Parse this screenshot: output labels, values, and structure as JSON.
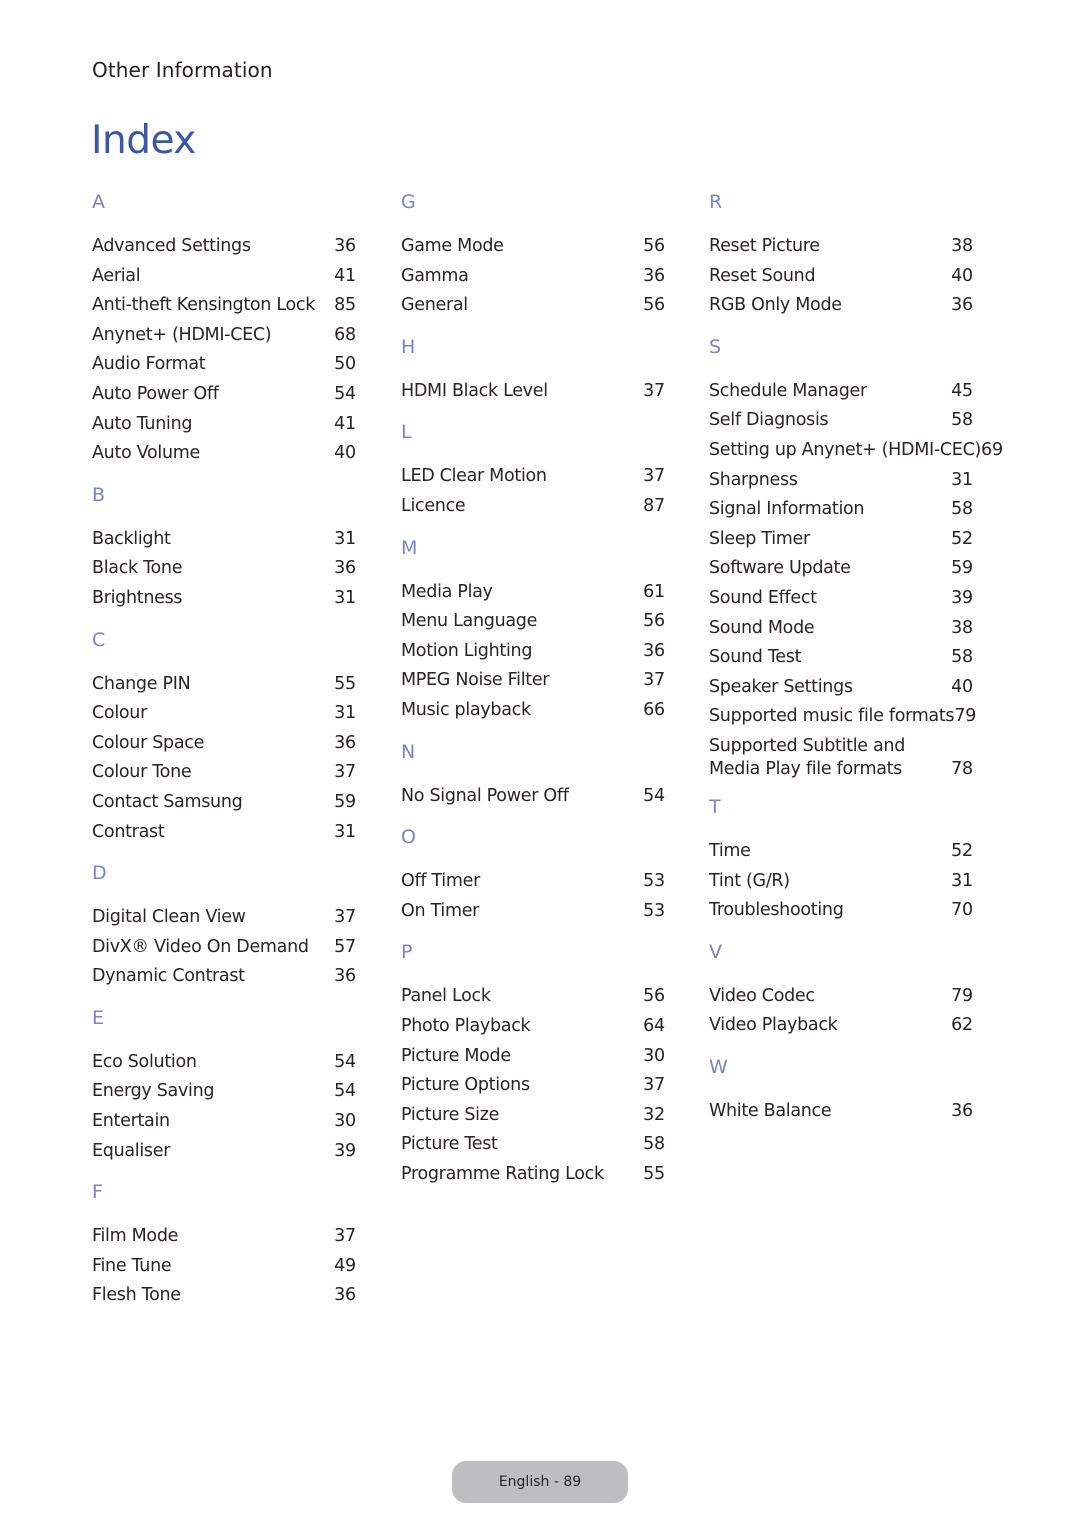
{
  "header": {
    "section": "Other Information",
    "title": "Index"
  },
  "colors": {
    "title": "#3a58a3",
    "letter": "#7b83c4",
    "text": "#2a2326",
    "footer_bg": "#bdbec0"
  },
  "columns": [
    {
      "groups": [
        {
          "letter": "A",
          "entries": [
            {
              "term": "Advanced Settings",
              "page": "36"
            },
            {
              "term": "Aerial",
              "page": "41"
            },
            {
              "term": "Anti-theft Kensington Lock",
              "page": "85"
            },
            {
              "term": "Anynet+ (HDMI-CEC)",
              "page": "68"
            },
            {
              "term": "Audio Format",
              "page": "50"
            },
            {
              "term": "Auto Power Off",
              "page": "54"
            },
            {
              "term": "Auto Tuning",
              "page": "41"
            },
            {
              "term": "Auto Volume",
              "page": "40"
            }
          ]
        },
        {
          "letter": "B",
          "entries": [
            {
              "term": "Backlight",
              "page": "31"
            },
            {
              "term": "Black Tone",
              "page": "36"
            },
            {
              "term": "Brightness",
              "page": "31"
            }
          ]
        },
        {
          "letter": "C",
          "entries": [
            {
              "term": "Change PIN",
              "page": "55"
            },
            {
              "term": "Colour",
              "page": "31"
            },
            {
              "term": "Colour Space",
              "page": "36"
            },
            {
              "term": "Colour Tone",
              "page": "37"
            },
            {
              "term": "Contact Samsung",
              "page": "59"
            },
            {
              "term": "Contrast",
              "page": "31"
            }
          ]
        },
        {
          "letter": "D",
          "entries": [
            {
              "term": "Digital Clean View",
              "page": "37"
            },
            {
              "term": "DivX® Video On Demand",
              "page": "57"
            },
            {
              "term": "Dynamic Contrast",
              "page": "36"
            }
          ]
        },
        {
          "letter": "E",
          "entries": [
            {
              "term": "Eco Solution",
              "page": "54"
            },
            {
              "term": "Energy Saving",
              "page": "54"
            },
            {
              "term": "Entertain",
              "page": "30"
            },
            {
              "term": "Equaliser",
              "page": "39"
            }
          ]
        },
        {
          "letter": "F",
          "entries": [
            {
              "term": "Film Mode",
              "page": "37"
            },
            {
              "term": "Fine Tune",
              "page": "49"
            },
            {
              "term": "Flesh Tone",
              "page": "36"
            }
          ]
        }
      ]
    },
    {
      "groups": [
        {
          "letter": "G",
          "entries": [
            {
              "term": "Game Mode",
              "page": "56"
            },
            {
              "term": "Gamma",
              "page": "36"
            },
            {
              "term": "General",
              "page": "56"
            }
          ]
        },
        {
          "letter": "H",
          "entries": [
            {
              "term": "HDMI Black Level",
              "page": "37"
            }
          ]
        },
        {
          "letter": "L",
          "entries": [
            {
              "term": "LED Clear Motion",
              "page": "37"
            },
            {
              "term": "Licence",
              "page": "87"
            }
          ]
        },
        {
          "letter": "M",
          "entries": [
            {
              "term": "Media Play",
              "page": "61"
            },
            {
              "term": "Menu Language",
              "page": "56"
            },
            {
              "term": "Motion Lighting",
              "page": "36"
            },
            {
              "term": "MPEG Noise Filter",
              "page": "37"
            },
            {
              "term": "Music playback",
              "page": "66"
            }
          ]
        },
        {
          "letter": "N",
          "entries": [
            {
              "term": "No Signal Power Off",
              "page": "54"
            }
          ]
        },
        {
          "letter": "O",
          "entries": [
            {
              "term": "Off Timer",
              "page": "53"
            },
            {
              "term": "On Timer",
              "page": "53"
            }
          ]
        },
        {
          "letter": "P",
          "entries": [
            {
              "term": "Panel Lock",
              "page": "56"
            },
            {
              "term": "Photo Playback",
              "page": "64"
            },
            {
              "term": "Picture Mode",
              "page": "30"
            },
            {
              "term": "Picture Options",
              "page": "37"
            },
            {
              "term": "Picture Size",
              "page": "32"
            },
            {
              "term": "Picture Test",
              "page": "58"
            },
            {
              "term": "Programme Rating Lock",
              "page": "55"
            }
          ]
        }
      ]
    },
    {
      "groups": [
        {
          "letter": "R",
          "entries": [
            {
              "term": "Reset Picture",
              "page": "38"
            },
            {
              "term": "Reset Sound",
              "page": "40"
            },
            {
              "term": "RGB Only Mode",
              "page": "36"
            }
          ]
        },
        {
          "letter": "S",
          "entries": [
            {
              "term": "Schedule Manager",
              "page": "45"
            },
            {
              "term": "Self Diagnosis",
              "page": "58"
            },
            {
              "term": "Setting up Anynet+ (HDMI-CEC)",
              "page": "69",
              "overflow": true
            },
            {
              "term": "Sharpness",
              "page": "31"
            },
            {
              "term": "Signal Information",
              "page": "58"
            },
            {
              "term": "Sleep Timer",
              "page": "52"
            },
            {
              "term": "Software Update",
              "page": "59"
            },
            {
              "term": "Sound Effect",
              "page": "39"
            },
            {
              "term": "Sound Mode",
              "page": "38"
            },
            {
              "term": "Sound Test",
              "page": "58"
            },
            {
              "term": "Speaker Settings",
              "page": "40"
            },
            {
              "term": "Supported music file formats",
              "page": "79"
            },
            {
              "term": "Supported Subtitle and Media Play file formats",
              "page": "78",
              "wrap": true
            }
          ]
        },
        {
          "letter": "T",
          "entries": [
            {
              "term": "Time",
              "page": "52"
            },
            {
              "term": "Tint (G/R)",
              "page": "31"
            },
            {
              "term": "Troubleshooting",
              "page": "70"
            }
          ]
        },
        {
          "letter": "V",
          "entries": [
            {
              "term": "Video Codec",
              "page": "79"
            },
            {
              "term": "Video Playback",
              "page": "62"
            }
          ]
        },
        {
          "letter": "W",
          "entries": [
            {
              "term": "White Balance",
              "page": "36"
            }
          ]
        }
      ]
    }
  ],
  "footer": {
    "page_label": "English - 89"
  }
}
